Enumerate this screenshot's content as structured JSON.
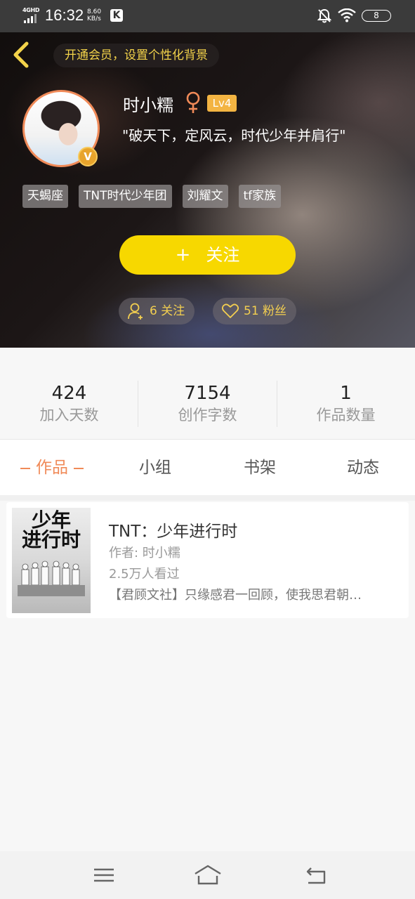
{
  "status_bar": {
    "network": "4GHD",
    "time": "16:32",
    "speed_value": "8.60",
    "speed_unit": "KB/s",
    "app_icon_letter": "K",
    "battery": "8",
    "icons": [
      "signal-icon",
      "bell-muted-icon",
      "wifi-icon",
      "battery-icon"
    ]
  },
  "header": {
    "back_icon": "chevron-left-icon",
    "vip_prompt": "开通会员，设置个性化背景",
    "username": "时小糯",
    "gender_symbol": "♀",
    "level": "Lv4",
    "verified_badge": "V",
    "motto": "\"破天下，定风云，时代少年并肩行\"",
    "tags": [
      "天蝎座",
      "TNT时代少年团",
      "刘耀文",
      "tf家族"
    ],
    "follow_plus": "+",
    "follow_label": "关注",
    "following_count": "6 关注",
    "fans_count": "51 粉丝"
  },
  "stats": [
    {
      "value": "424",
      "label": "加入天数"
    },
    {
      "value": "7154",
      "label": "创作字数"
    },
    {
      "value": "1",
      "label": "作品数量"
    }
  ],
  "tabs": [
    {
      "label": "作品",
      "active": true
    },
    {
      "label": "小组",
      "active": false
    },
    {
      "label": "书架",
      "active": false
    },
    {
      "label": "动态",
      "active": false
    }
  ],
  "works": [
    {
      "cover_title_line1": "少年",
      "cover_title_line2": "进行时",
      "title": "TNT：少年进行时",
      "author": "作者: 时小糯",
      "views": "2.5万人看过",
      "description": "【君顾文社】只缘感君一回顾，使我思君朝…"
    }
  ],
  "nav_bar": {
    "icons": [
      "menu-icon",
      "home-icon",
      "back-icon"
    ]
  },
  "colors": {
    "accent": "#f08a58",
    "follow_button": "#f7d800",
    "vip_text": "#f3d34a",
    "level_badge": "#f3b442"
  }
}
